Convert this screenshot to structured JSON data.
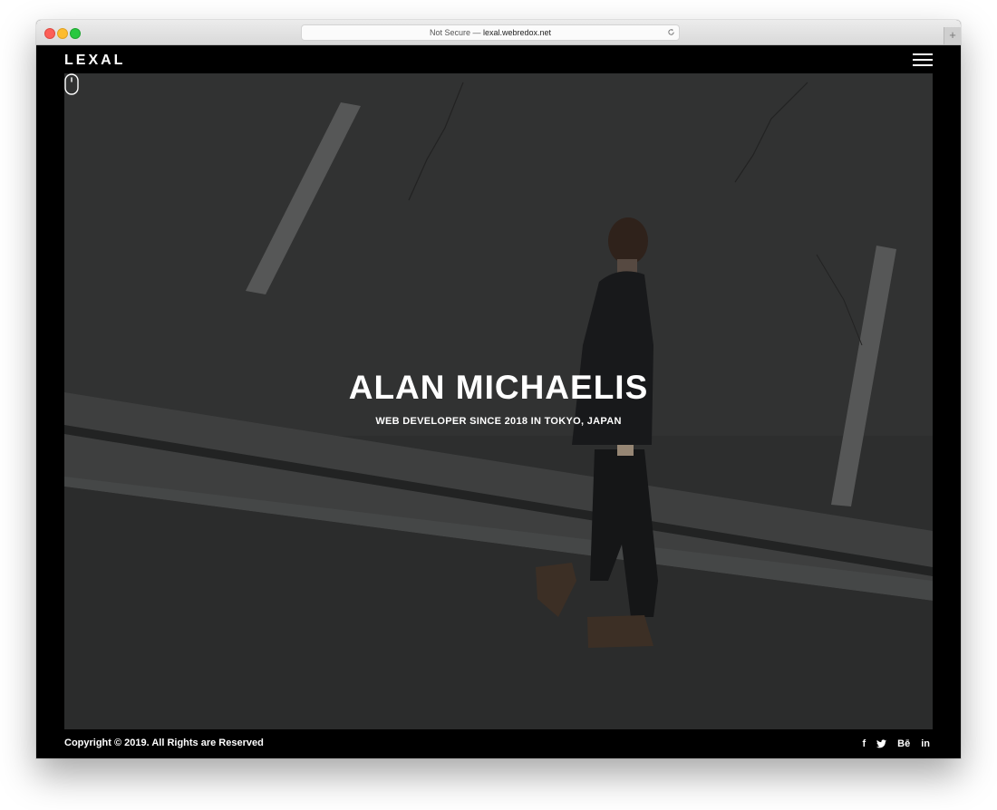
{
  "browser": {
    "address_prefix": "Not Secure — ",
    "address_host": "lexal.webredox.net",
    "newtab_label": "+"
  },
  "nav": {
    "logo": "LEXAL"
  },
  "hero": {
    "title": "ALAN MICHAELIS",
    "subtitle": "WEB DEVELOPER SINCE 2018 IN TOKYO, JAPAN"
  },
  "footer": {
    "copyright": "Copyright © 2019. All Rights are Reserved",
    "social": [
      {
        "name": "facebook-icon",
        "glyph": "f"
      },
      {
        "name": "twitter-icon",
        "glyph": "🐦"
      },
      {
        "name": "behance-icon",
        "glyph": "Bē"
      },
      {
        "name": "linkedin-icon",
        "glyph": "in"
      }
    ]
  },
  "colors": {
    "page_bg": "#000000",
    "text": "#ffffff",
    "photo_overlay": "#2f3030"
  }
}
